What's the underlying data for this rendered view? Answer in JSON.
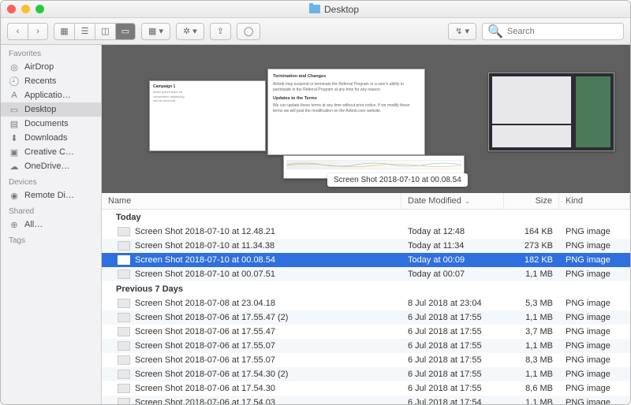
{
  "title": "Desktop",
  "nav": {
    "back": "‹",
    "forward": "›"
  },
  "views": [
    "icon",
    "list",
    "column",
    "gallery"
  ],
  "toolbar": {
    "group": "▦ ▾",
    "action": "✲ ▾",
    "share": "⇪",
    "tag": "◯",
    "sync": "↯ ▾"
  },
  "search": {
    "placeholder": "Search",
    "icon": "🔍"
  },
  "sidebar": {
    "sections": [
      {
        "head": "Favorites",
        "items": [
          {
            "icon": "◎",
            "label": "AirDrop"
          },
          {
            "icon": "🕘",
            "label": "Recents"
          },
          {
            "icon": "A",
            "label": "Applicatio…"
          },
          {
            "icon": "▭",
            "label": "Desktop",
            "sel": true
          },
          {
            "icon": "▤",
            "label": "Documents"
          },
          {
            "icon": "⬇",
            "label": "Downloads"
          },
          {
            "icon": "▣",
            "label": "Creative C…"
          },
          {
            "icon": "☁",
            "label": "OneDrive…"
          }
        ]
      },
      {
        "head": "Devices",
        "items": [
          {
            "icon": "◉",
            "label": "Remote Di…"
          }
        ]
      },
      {
        "head": "Shared",
        "items": [
          {
            "icon": "⊕",
            "label": "All…"
          }
        ]
      },
      {
        "head": "Tags",
        "items": []
      }
    ]
  },
  "gallery": {
    "caption": "Screen Shot 2018-07-10 at 00.08.54",
    "doc_h1": "Termination and Changes",
    "doc_h2": "Updates to the Terms"
  },
  "columns": {
    "name": "Name",
    "date": "Date Modified",
    "size": "Size",
    "kind": "Kind"
  },
  "groups": [
    {
      "label": "Today",
      "rows": [
        {
          "name": "Screen Shot 2018-07-10 at 12.48.21",
          "date": "Today at 12:48",
          "size": "164 KB",
          "kind": "PNG image"
        },
        {
          "name": "Screen Shot 2018-07-10 at 11.34.38",
          "date": "Today at 11:34",
          "size": "273 KB",
          "kind": "PNG image"
        },
        {
          "name": "Screen Shot 2018-07-10 at 00.08.54",
          "date": "Today at 00:09",
          "size": "182 KB",
          "kind": "PNG image",
          "sel": true
        },
        {
          "name": "Screen Shot 2018-07-10 at 00.07.51",
          "date": "Today at 00:07",
          "size": "1,1 MB",
          "kind": "PNG image"
        }
      ]
    },
    {
      "label": "Previous 7 Days",
      "rows": [
        {
          "name": "Screen Shot 2018-07-08 at 23.04.18",
          "date": "8 Jul 2018 at 23:04",
          "size": "5,3 MB",
          "kind": "PNG image"
        },
        {
          "name": "Screen Shot 2018-07-06 at 17.55.47 (2)",
          "date": "6 Jul 2018 at 17:55",
          "size": "1,1 MB",
          "kind": "PNG image"
        },
        {
          "name": "Screen Shot 2018-07-06 at 17.55.47",
          "date": "6 Jul 2018 at 17:55",
          "size": "3,7 MB",
          "kind": "PNG image"
        },
        {
          "name": "Screen Shot 2018-07-06 at 17.55.07",
          "date": "6 Jul 2018 at 17:55",
          "size": "1,1 MB",
          "kind": "PNG image"
        },
        {
          "name": "Screen Shot 2018-07-06 at 17.55.07",
          "date": "6 Jul 2018 at 17:55",
          "size": "8,3 MB",
          "kind": "PNG image"
        },
        {
          "name": "Screen Shot 2018-07-06 at 17.54.30 (2)",
          "date": "6 Jul 2018 at 17:55",
          "size": "1,1 MB",
          "kind": "PNG image"
        },
        {
          "name": "Screen Shot 2018-07-06 at 17.54.30",
          "date": "6 Jul 2018 at 17:55",
          "size": "8,6 MB",
          "kind": "PNG image"
        },
        {
          "name": "Screen Shot 2018-07-06 at 17.54.03",
          "date": "6 Jul 2018 at 17:54",
          "size": "1,1 MB",
          "kind": "PNG image"
        }
      ]
    }
  ]
}
